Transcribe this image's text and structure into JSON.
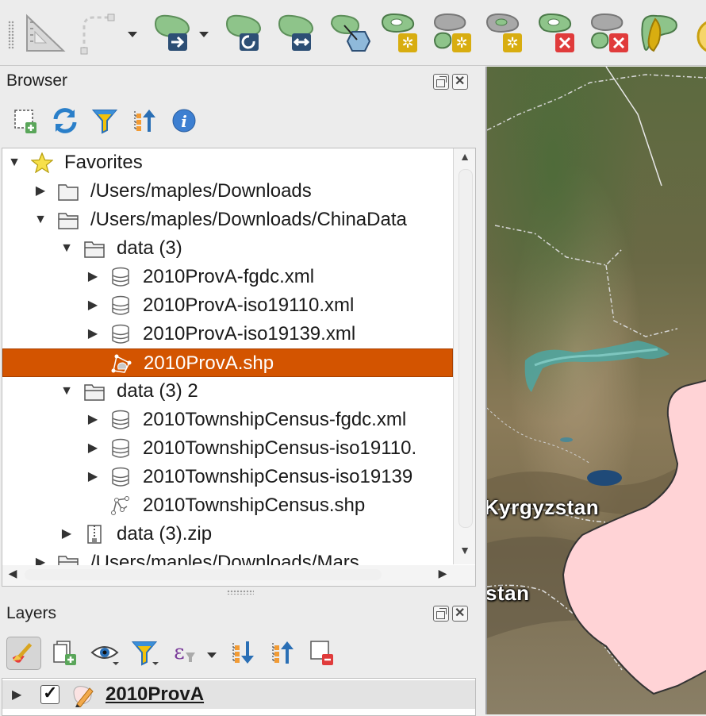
{
  "toolbar": {
    "tools": [
      {
        "name": "measure-icon"
      },
      {
        "name": "select-dashed-icon"
      },
      {
        "name": "move-feature-icon"
      },
      {
        "name": "rotate-feature-icon"
      },
      {
        "name": "simplify-feature-icon"
      },
      {
        "name": "offset-curve-icon"
      },
      {
        "name": "add-ring-icon"
      },
      {
        "name": "add-part-icon"
      },
      {
        "name": "fill-ring-icon"
      },
      {
        "name": "delete-ring-icon"
      },
      {
        "name": "delete-part-icon"
      },
      {
        "name": "reshape-feature-icon"
      }
    ]
  },
  "browser": {
    "title": "Browser",
    "tree": [
      {
        "label": "Favorites",
        "level": 0,
        "expanded": true,
        "arrow": "down",
        "icon": "star"
      },
      {
        "label": "/Users/maples/Downloads",
        "level": 1,
        "arrow": "right",
        "icon": "folder"
      },
      {
        "label": "/Users/maples/Downloads/ChinaData",
        "level": 1,
        "arrow": "down",
        "icon": "folder-open"
      },
      {
        "label": "data (3)",
        "level": 2,
        "arrow": "down",
        "icon": "folder-open"
      },
      {
        "label": "2010ProvA-fgdc.xml",
        "level": 3,
        "arrow": "right",
        "icon": "database"
      },
      {
        "label": "2010ProvA-iso19110.xml",
        "level": 3,
        "arrow": "right",
        "icon": "database"
      },
      {
        "label": "2010ProvA-iso19139.xml",
        "level": 3,
        "arrow": "right",
        "icon": "database"
      },
      {
        "label": "2010ProvA.shp",
        "level": 3,
        "arrow": "none",
        "icon": "polygon",
        "selected": true
      },
      {
        "label": "data (3) 2",
        "level": 2,
        "arrow": "down",
        "icon": "folder-open"
      },
      {
        "label": "2010TownshipCensus-fgdc.xml",
        "level": 3,
        "arrow": "right",
        "icon": "database"
      },
      {
        "label": "2010TownshipCensus-iso19110.",
        "level": 3,
        "arrow": "right",
        "icon": "database"
      },
      {
        "label": "2010TownshipCensus-iso19139",
        "level": 3,
        "arrow": "right",
        "icon": "database"
      },
      {
        "label": "2010TownshipCensus.shp",
        "level": 3,
        "arrow": "none",
        "icon": "line"
      },
      {
        "label": "data (3).zip",
        "level": 2,
        "arrow": "right",
        "icon": "zip"
      },
      {
        "label": "/Users/maples/Downloads/Mars",
        "level": 1,
        "arrow": "right",
        "icon": "folder-open"
      }
    ]
  },
  "layers": {
    "title": "Layers",
    "items": [
      {
        "label": "2010ProvA",
        "checked": true
      }
    ]
  },
  "map": {
    "labels": [
      "Kyrgyzstan",
      "stan"
    ]
  },
  "colors": {
    "selection": "#d35400",
    "polygon_fill": "#ffd3d6",
    "tool_green": "#8ec48a"
  }
}
